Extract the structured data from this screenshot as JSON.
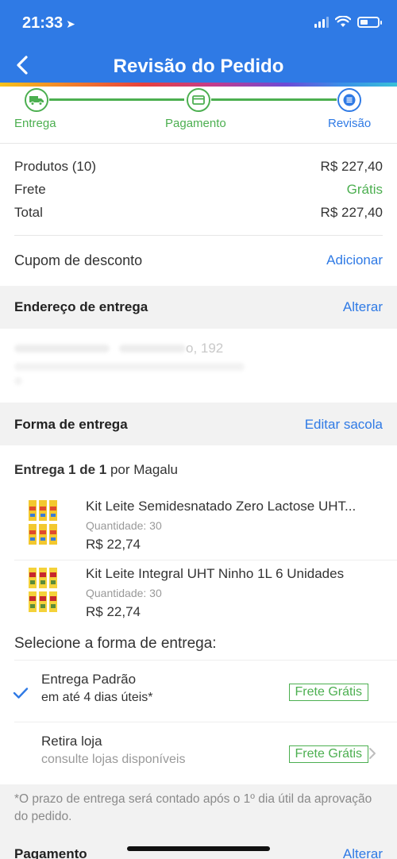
{
  "status_bar": {
    "time": "21:33"
  },
  "header": {
    "title": "Revisão do Pedido"
  },
  "colors": {
    "accent": "#2f7ae5",
    "success": "#4caf50",
    "muted": "#999999"
  },
  "steps": [
    {
      "label": "Entrega",
      "icon": "truck-icon",
      "state": "done"
    },
    {
      "label": "Pagamento",
      "icon": "card-icon",
      "state": "done"
    },
    {
      "label": "Revisão",
      "icon": "list-icon",
      "state": "current"
    }
  ],
  "summary": {
    "products_label": "Produtos (10)",
    "products_value": "R$ 227,40",
    "shipping_label": "Frete",
    "shipping_value": "Grátis",
    "total_label": "Total",
    "total_value": "R$ 227,40"
  },
  "coupon": {
    "label": "Cupom de desconto",
    "action": "Adicionar"
  },
  "address": {
    "title": "Endereço de entrega",
    "action": "Alterar",
    "line1": "o, 192"
  },
  "delivery": {
    "title": "Forma de entrega",
    "action": "Editar sacola",
    "shipment_bold": "Entrega 1 de 1",
    "shipment_rest": " por Magalu"
  },
  "products": [
    {
      "name": "Kit Leite Semidesnatado Zero Lactose UHT...",
      "qty": "Quantidade: 30",
      "price": "R$ 22,74"
    },
    {
      "name": "Kit Leite Integral UHT Ninho 1L 6 Unidades",
      "qty": "Quantidade: 30",
      "price": "R$ 22,74"
    }
  ],
  "shipping_options": {
    "heading": "Selecione a forma de entrega:",
    "options": [
      {
        "title": "Entrega Padrão",
        "subtitle": "em até 4 dias úteis*",
        "badge": "Frete Grátis",
        "selected": true
      },
      {
        "title": "Retira loja",
        "subtitle": "consulte lojas disponíveis",
        "badge": "Frete Grátis",
        "selected": false
      }
    ]
  },
  "note": "*O prazo de entrega será contado após o 1º dia útil da aprovação do pedido.",
  "payment": {
    "title": "Pagamento",
    "action": "Alterar"
  }
}
